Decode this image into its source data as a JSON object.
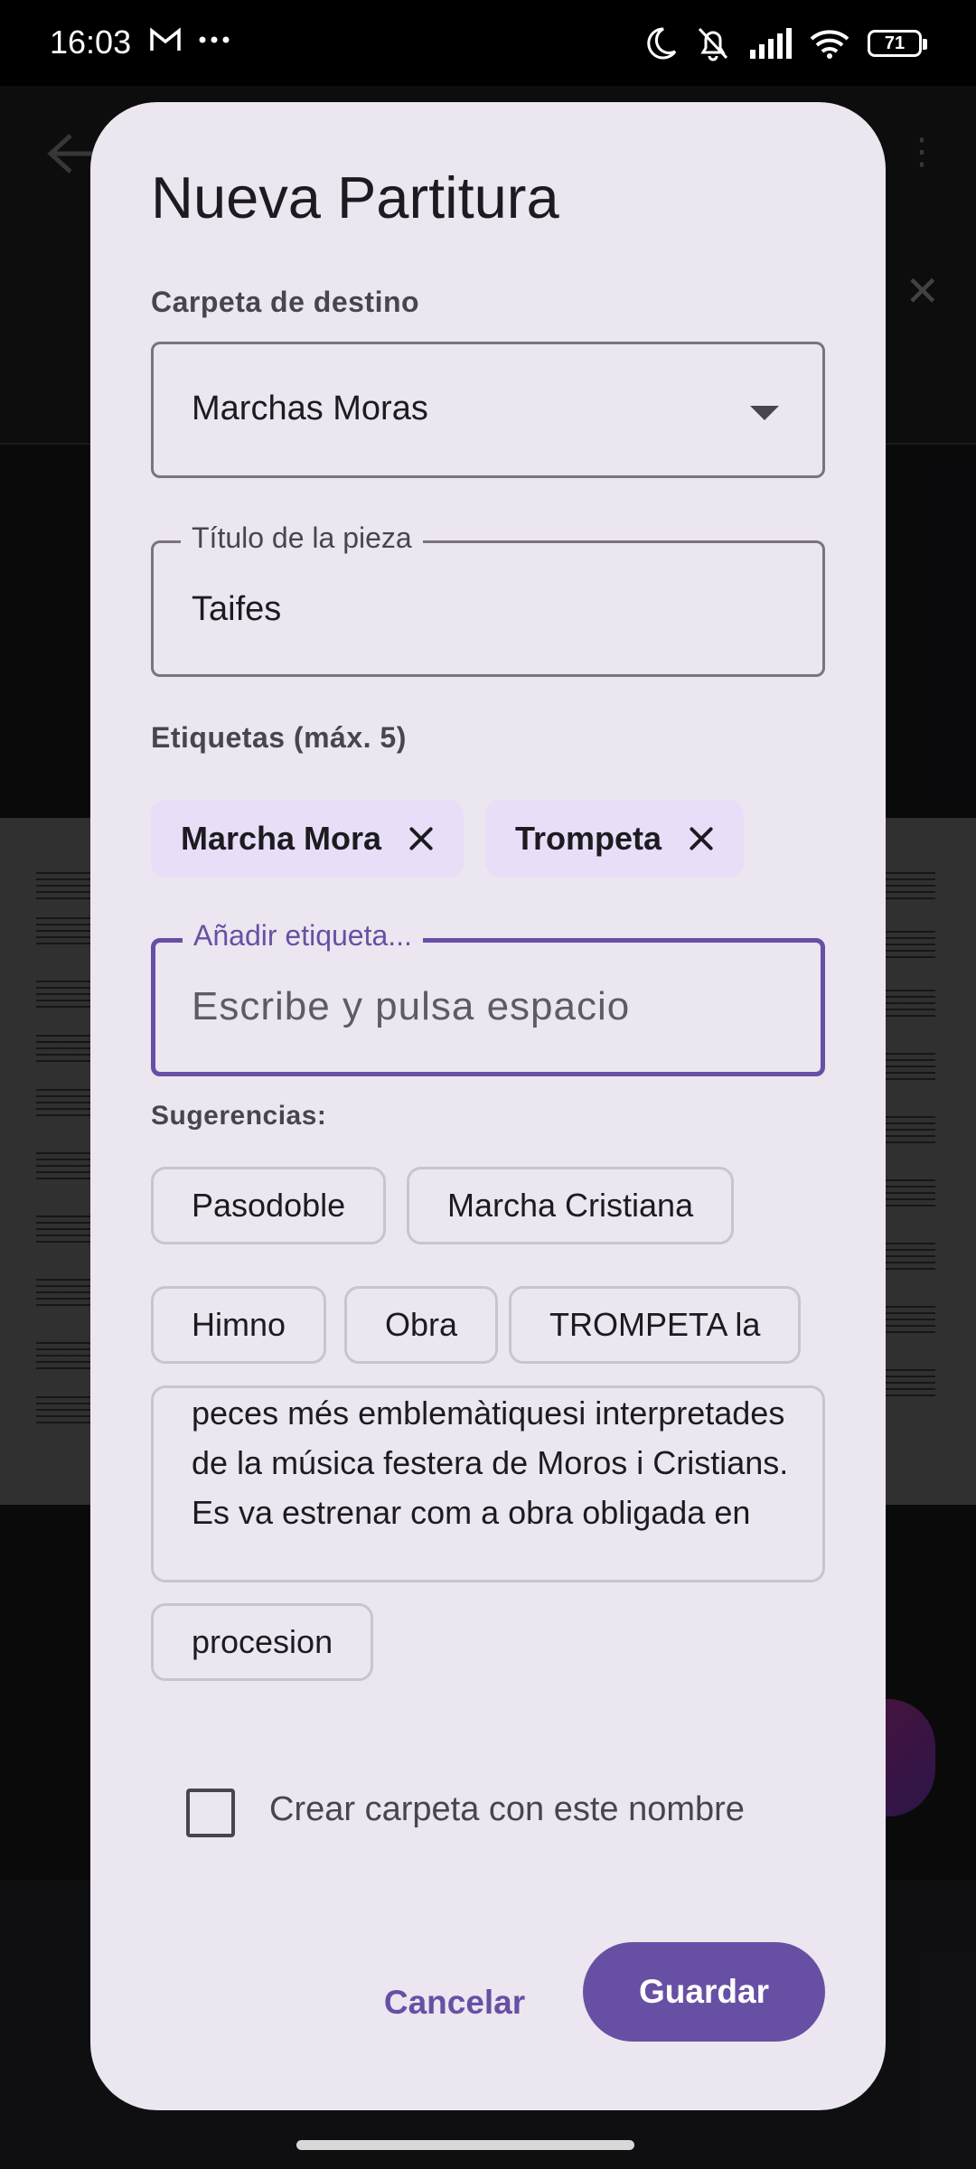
{
  "status_bar": {
    "time": "16:03",
    "left_icons": [
      "gmail-icon",
      "more-dots-icon"
    ],
    "right_icons": [
      "moon-icon",
      "bell-off-icon",
      "signal-icon",
      "wifi-icon",
      "battery-icon"
    ],
    "battery": "71"
  },
  "dialog": {
    "title": "Nueva Partitura",
    "folder_label": "Carpeta de destino",
    "folder_value": "Marchas Moras",
    "title_field_label": "Título de la pieza",
    "title_field_value": "Taifes",
    "tags_label": "Etiquetas (máx. 5)",
    "selected_tags": [
      {
        "label": "Marcha Mora"
      },
      {
        "label": "Trompeta"
      }
    ],
    "add_tag_label": "Añadir etiqueta...",
    "add_tag_placeholder": "Escribe y pulsa espacio",
    "suggestions_label": "Sugerencias:",
    "suggestions": [
      "Pasodoble",
      "Marcha Cristiana",
      "Himno",
      "Obra",
      "TROMPETA la",
      "peces més emblemàtiquesi interpretades de la música festera de Moros i Cristians. Es va estrenar com a obra obligada en",
      "procesion"
    ],
    "checkbox_label": "Crear carpeta con este nombre",
    "checkbox_checked": false,
    "cancel_label": "Cancelar",
    "save_label": "Guardar"
  },
  "colors": {
    "dialog_bg": "#ece6f0",
    "primary": "#6750a4",
    "chip_selected_bg": "#e8def8"
  }
}
